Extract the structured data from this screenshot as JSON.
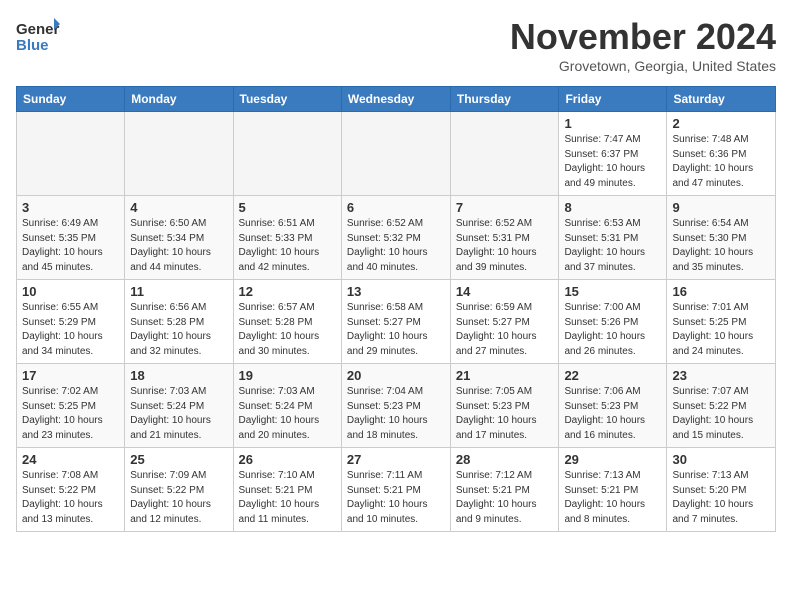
{
  "header": {
    "logo_general": "General",
    "logo_blue": "Blue",
    "month_title": "November 2024",
    "location": "Grovetown, Georgia, United States"
  },
  "weekdays": [
    "Sunday",
    "Monday",
    "Tuesday",
    "Wednesday",
    "Thursday",
    "Friday",
    "Saturday"
  ],
  "weeks": [
    [
      {
        "day": "",
        "empty": true
      },
      {
        "day": "",
        "empty": true
      },
      {
        "day": "",
        "empty": true
      },
      {
        "day": "",
        "empty": true
      },
      {
        "day": "",
        "empty": true
      },
      {
        "day": "1",
        "sunrise": "Sunrise: 7:47 AM",
        "sunset": "Sunset: 6:37 PM",
        "daylight": "Daylight: 10 hours and 49 minutes."
      },
      {
        "day": "2",
        "sunrise": "Sunrise: 7:48 AM",
        "sunset": "Sunset: 6:36 PM",
        "daylight": "Daylight: 10 hours and 47 minutes."
      }
    ],
    [
      {
        "day": "3",
        "sunrise": "Sunrise: 6:49 AM",
        "sunset": "Sunset: 5:35 PM",
        "daylight": "Daylight: 10 hours and 45 minutes."
      },
      {
        "day": "4",
        "sunrise": "Sunrise: 6:50 AM",
        "sunset": "Sunset: 5:34 PM",
        "daylight": "Daylight: 10 hours and 44 minutes."
      },
      {
        "day": "5",
        "sunrise": "Sunrise: 6:51 AM",
        "sunset": "Sunset: 5:33 PM",
        "daylight": "Daylight: 10 hours and 42 minutes."
      },
      {
        "day": "6",
        "sunrise": "Sunrise: 6:52 AM",
        "sunset": "Sunset: 5:32 PM",
        "daylight": "Daylight: 10 hours and 40 minutes."
      },
      {
        "day": "7",
        "sunrise": "Sunrise: 6:52 AM",
        "sunset": "Sunset: 5:31 PM",
        "daylight": "Daylight: 10 hours and 39 minutes."
      },
      {
        "day": "8",
        "sunrise": "Sunrise: 6:53 AM",
        "sunset": "Sunset: 5:31 PM",
        "daylight": "Daylight: 10 hours and 37 minutes."
      },
      {
        "day": "9",
        "sunrise": "Sunrise: 6:54 AM",
        "sunset": "Sunset: 5:30 PM",
        "daylight": "Daylight: 10 hours and 35 minutes."
      }
    ],
    [
      {
        "day": "10",
        "sunrise": "Sunrise: 6:55 AM",
        "sunset": "Sunset: 5:29 PM",
        "daylight": "Daylight: 10 hours and 34 minutes."
      },
      {
        "day": "11",
        "sunrise": "Sunrise: 6:56 AM",
        "sunset": "Sunset: 5:28 PM",
        "daylight": "Daylight: 10 hours and 32 minutes."
      },
      {
        "day": "12",
        "sunrise": "Sunrise: 6:57 AM",
        "sunset": "Sunset: 5:28 PM",
        "daylight": "Daylight: 10 hours and 30 minutes."
      },
      {
        "day": "13",
        "sunrise": "Sunrise: 6:58 AM",
        "sunset": "Sunset: 5:27 PM",
        "daylight": "Daylight: 10 hours and 29 minutes."
      },
      {
        "day": "14",
        "sunrise": "Sunrise: 6:59 AM",
        "sunset": "Sunset: 5:27 PM",
        "daylight": "Daylight: 10 hours and 27 minutes."
      },
      {
        "day": "15",
        "sunrise": "Sunrise: 7:00 AM",
        "sunset": "Sunset: 5:26 PM",
        "daylight": "Daylight: 10 hours and 26 minutes."
      },
      {
        "day": "16",
        "sunrise": "Sunrise: 7:01 AM",
        "sunset": "Sunset: 5:25 PM",
        "daylight": "Daylight: 10 hours and 24 minutes."
      }
    ],
    [
      {
        "day": "17",
        "sunrise": "Sunrise: 7:02 AM",
        "sunset": "Sunset: 5:25 PM",
        "daylight": "Daylight: 10 hours and 23 minutes."
      },
      {
        "day": "18",
        "sunrise": "Sunrise: 7:03 AM",
        "sunset": "Sunset: 5:24 PM",
        "daylight": "Daylight: 10 hours and 21 minutes."
      },
      {
        "day": "19",
        "sunrise": "Sunrise: 7:03 AM",
        "sunset": "Sunset: 5:24 PM",
        "daylight": "Daylight: 10 hours and 20 minutes."
      },
      {
        "day": "20",
        "sunrise": "Sunrise: 7:04 AM",
        "sunset": "Sunset: 5:23 PM",
        "daylight": "Daylight: 10 hours and 18 minutes."
      },
      {
        "day": "21",
        "sunrise": "Sunrise: 7:05 AM",
        "sunset": "Sunset: 5:23 PM",
        "daylight": "Daylight: 10 hours and 17 minutes."
      },
      {
        "day": "22",
        "sunrise": "Sunrise: 7:06 AM",
        "sunset": "Sunset: 5:23 PM",
        "daylight": "Daylight: 10 hours and 16 minutes."
      },
      {
        "day": "23",
        "sunrise": "Sunrise: 7:07 AM",
        "sunset": "Sunset: 5:22 PM",
        "daylight": "Daylight: 10 hours and 15 minutes."
      }
    ],
    [
      {
        "day": "24",
        "sunrise": "Sunrise: 7:08 AM",
        "sunset": "Sunset: 5:22 PM",
        "daylight": "Daylight: 10 hours and 13 minutes."
      },
      {
        "day": "25",
        "sunrise": "Sunrise: 7:09 AM",
        "sunset": "Sunset: 5:22 PM",
        "daylight": "Daylight: 10 hours and 12 minutes."
      },
      {
        "day": "26",
        "sunrise": "Sunrise: 7:10 AM",
        "sunset": "Sunset: 5:21 PM",
        "daylight": "Daylight: 10 hours and 11 minutes."
      },
      {
        "day": "27",
        "sunrise": "Sunrise: 7:11 AM",
        "sunset": "Sunset: 5:21 PM",
        "daylight": "Daylight: 10 hours and 10 minutes."
      },
      {
        "day": "28",
        "sunrise": "Sunrise: 7:12 AM",
        "sunset": "Sunset: 5:21 PM",
        "daylight": "Daylight: 10 hours and 9 minutes."
      },
      {
        "day": "29",
        "sunrise": "Sunrise: 7:13 AM",
        "sunset": "Sunset: 5:21 PM",
        "daylight": "Daylight: 10 hours and 8 minutes."
      },
      {
        "day": "30",
        "sunrise": "Sunrise: 7:13 AM",
        "sunset": "Sunset: 5:20 PM",
        "daylight": "Daylight: 10 hours and 7 minutes."
      }
    ]
  ]
}
